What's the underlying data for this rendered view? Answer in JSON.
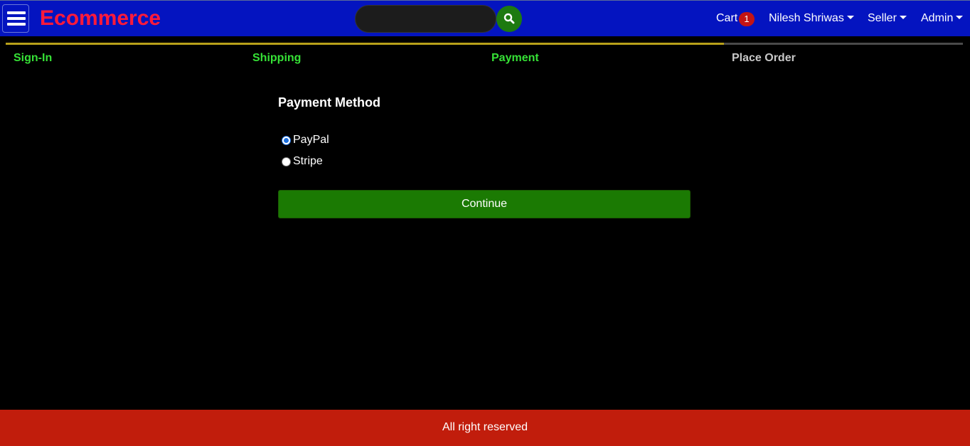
{
  "header": {
    "brand": "Ecommerce",
    "search": {
      "value": "",
      "placeholder": ""
    },
    "cart_label": "Cart",
    "cart_count": "1",
    "user_menu": "Nilesh Shriwas",
    "seller_menu": "Seller",
    "admin_menu": "Admin"
  },
  "steps": [
    {
      "label": "Sign-In",
      "active": true
    },
    {
      "label": "Shipping",
      "active": true
    },
    {
      "label": "Payment",
      "active": true
    },
    {
      "label": "Place Order",
      "active": false
    }
  ],
  "form": {
    "title": "Payment Method",
    "options": [
      {
        "label": "PayPal",
        "checked": true
      },
      {
        "label": "Stripe",
        "checked": false
      }
    ],
    "submit_label": "Continue"
  },
  "footer": {
    "text": "All right reserved"
  },
  "colors": {
    "header_bg": "#0414c0",
    "brand": "#ff1a3a",
    "active_step_text": "#36e136",
    "active_step_bar": "#b8a01a",
    "button_bg": "#1b7a03",
    "footer_bg": "#c11d0c",
    "badge_bg": "#c41414"
  },
  "icons": {
    "menu": "hamburger-icon",
    "search": "search-icon",
    "dropdown": "caret-down-icon"
  }
}
